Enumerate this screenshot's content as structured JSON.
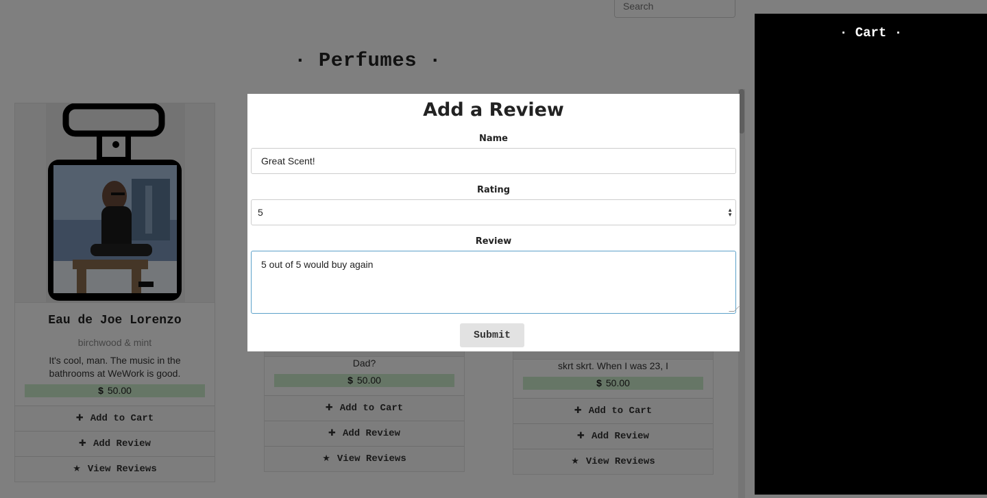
{
  "search": {
    "placeholder": "Search"
  },
  "page": {
    "title": "· Perfumes ·"
  },
  "cart": {
    "title": "· Cart ·"
  },
  "products": [
    {
      "name": "Eau de Joe Lorenzo",
      "notes": "birchwood & mint",
      "description": "It's cool, man. The music in the bathrooms at WeWork is good.",
      "price_symbol": "$",
      "price": "50.00"
    },
    {
      "name": "",
      "notes": "",
      "description": "Dad?",
      "price_symbol": "$",
      "price": "50.00"
    },
    {
      "name": "",
      "notes": "",
      "description": "skrt skrt. When I was 23, I",
      "price_symbol": "$",
      "price": "50.00"
    }
  ],
  "card_actions": {
    "add_to_cart": "Add to Cart",
    "add_review": "Add Review",
    "view_reviews": "View Reviews",
    "add_to_cart_icon": "plus-icon",
    "add_review_icon": "plus-icon",
    "view_reviews_icon": "star-icon"
  },
  "modal": {
    "title": "Add a Review",
    "name_label": "Name",
    "name_value": "Great Scent!",
    "rating_label": "Rating",
    "rating_value": "5",
    "review_label": "Review",
    "review_value": "5 out of 5 would buy again",
    "submit_label": "Submit"
  },
  "colors": {
    "overlay": "rgba(0,0,0,0.5)",
    "price_bg": "#cdeccd",
    "cart_bg": "#000000",
    "focus_border": "#5aa0c9"
  }
}
